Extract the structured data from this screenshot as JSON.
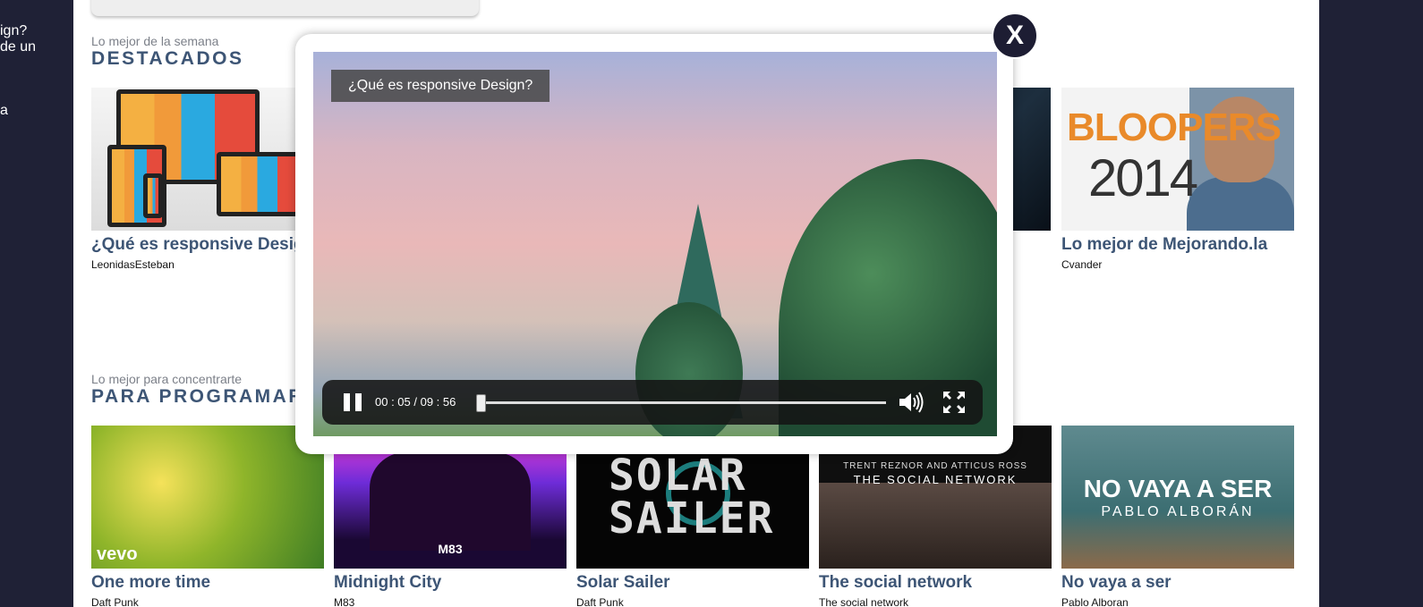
{
  "sidebar": {
    "snippets": [
      "ign?",
      "de un",
      "a"
    ]
  },
  "sections": [
    {
      "subtitle": "Lo mejor de la semana",
      "title": "DESTACADOS",
      "cards": [
        {
          "title": "¿Qué es responsive Design?",
          "author": "LeonidasEsteban"
        },
        {
          "title": "Lo mejor de Mejorando.la",
          "author": "Cvander",
          "thumb_text_1": "BLOOPERS",
          "thumb_text_2": "2014"
        }
      ]
    },
    {
      "subtitle": "Lo mejor para concentrarte",
      "title": "PARA PROGRAMAR",
      "cards": [
        {
          "title": "One more time",
          "author": "Daft Punk",
          "thumb_text_1": "vevo"
        },
        {
          "title": "Midnight City",
          "author": "M83",
          "thumb_text_1": "M83"
        },
        {
          "title": "Solar Sailer",
          "author": "Daft Punk",
          "thumb_text_1": "SOLAR",
          "thumb_text_2": "SAILER"
        },
        {
          "title": "The social network",
          "author": "The social network",
          "thumb_text_1": "TRENT REZNOR AND ATTICUS ROSS",
          "thumb_text_2": "THE SOCIAL NETWORK"
        },
        {
          "title": "No vaya a ser",
          "author": "Pablo Alboran",
          "thumb_text_1": "NO VAYA A SER",
          "thumb_text_2": "PABLO ALBORÁN"
        }
      ]
    }
  ],
  "player": {
    "video_title": "¿Qué es responsive Design?",
    "time": "00 : 05 / 09 : 56",
    "progress": 0.0084,
    "close_label": "X",
    "icons": {
      "pause": "pause-icon",
      "volume": "volume-icon",
      "fullscreen": "fullscreen-icon"
    }
  },
  "colors": {
    "accent": "#3d5575",
    "page_bg": "#1f2136",
    "close_bg": "#1d1d33"
  }
}
